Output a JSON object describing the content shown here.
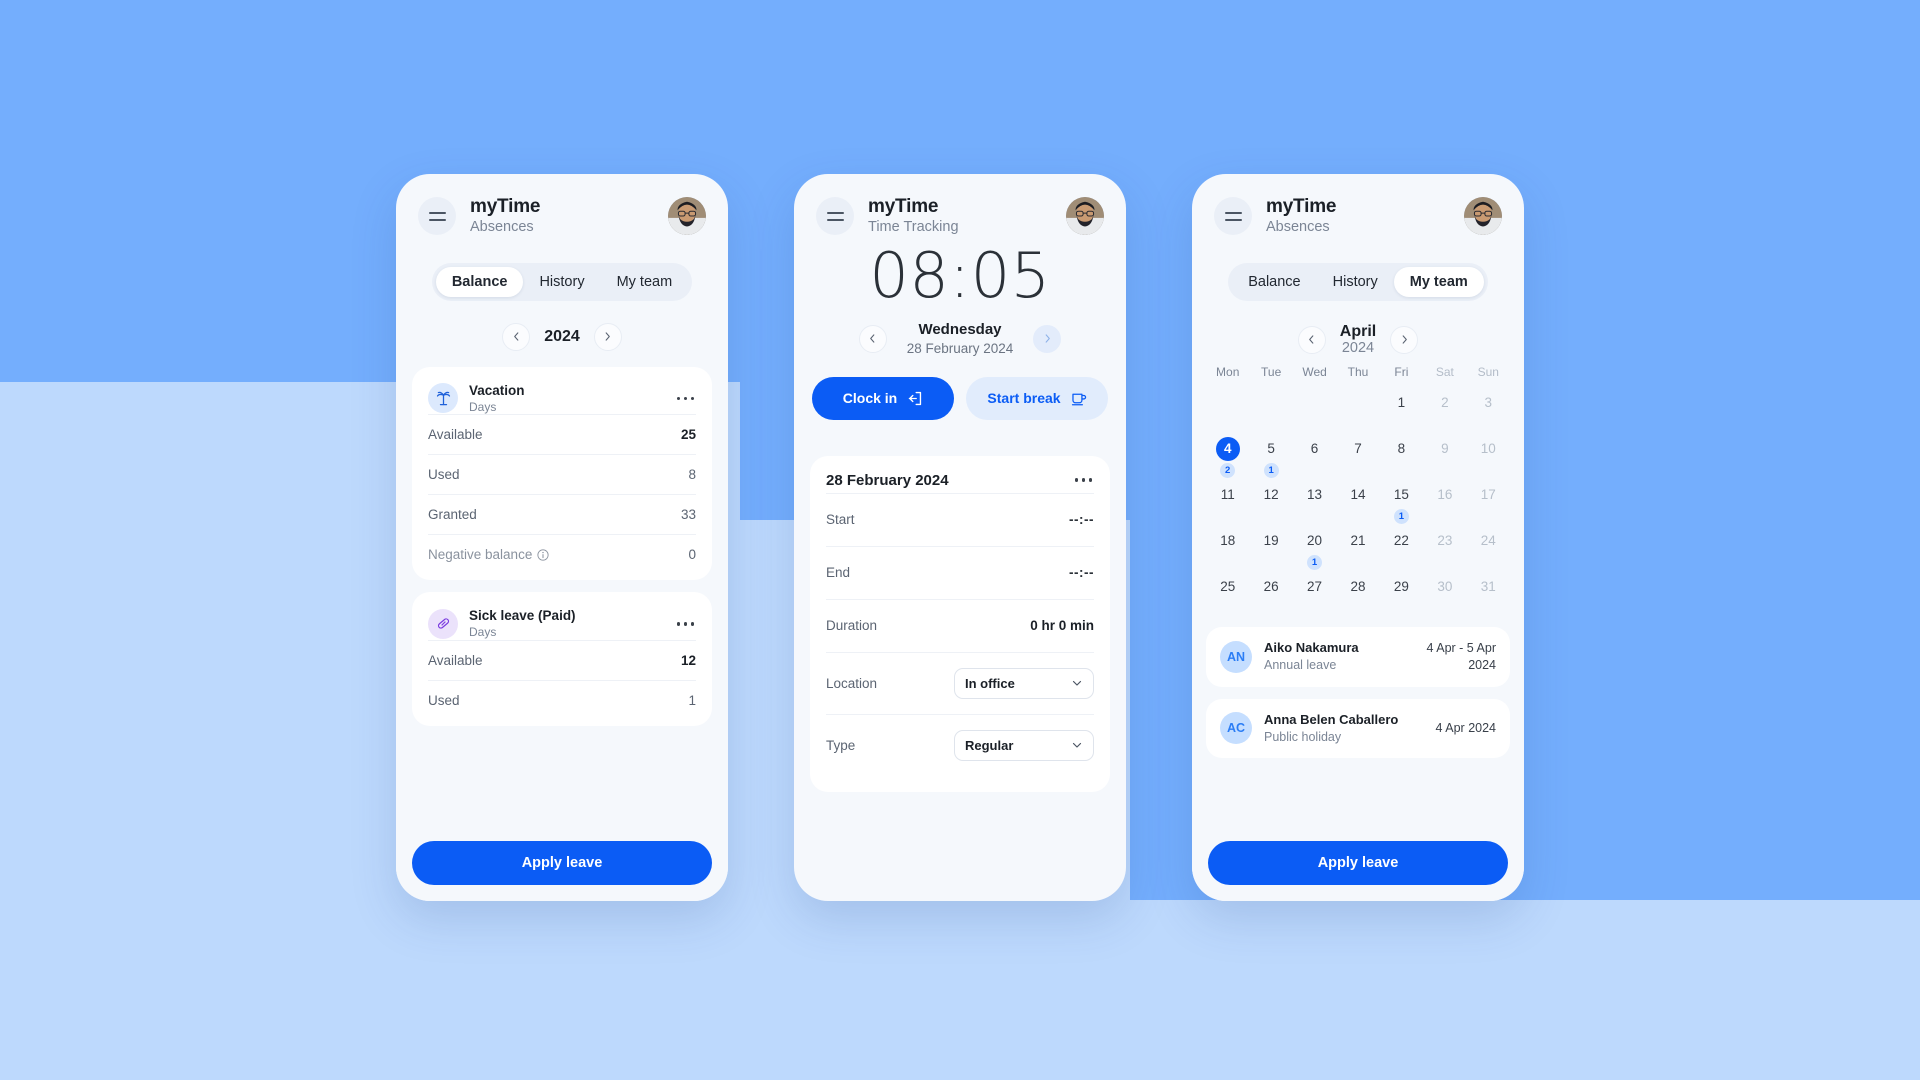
{
  "background": {
    "primary_blue": "#74aefd",
    "pale_blue": "#bdd9fd",
    "accent_blue": "#0b5cf5"
  },
  "phone1": {
    "header": {
      "title": "myTime",
      "subtitle": "Absences"
    },
    "tabs": [
      {
        "label": "Balance",
        "active": true
      },
      {
        "label": "History",
        "active": false
      },
      {
        "label": "My team",
        "active": false
      }
    ],
    "year_nav": {
      "prev": "‹",
      "value": "2024",
      "next": "›"
    },
    "cards": [
      {
        "icon": "palm-tree-icon",
        "name": "Vacation",
        "unit": "Days",
        "rows": [
          {
            "label": "Available",
            "value": "25",
            "strong": true
          },
          {
            "label": "Used",
            "value": "8",
            "strong": false
          },
          {
            "label": "Granted",
            "value": "33",
            "strong": false
          },
          {
            "label": "Negative balance",
            "value": "0",
            "strong": false,
            "info": true
          }
        ]
      },
      {
        "icon": "pill-icon",
        "name": "Sick leave (Paid)",
        "unit": "Days",
        "rows": [
          {
            "label": "Available",
            "value": "12",
            "strong": true
          },
          {
            "label": "Used",
            "value": "1",
            "strong": false
          }
        ]
      }
    ],
    "cta": "Apply leave"
  },
  "phone2": {
    "header": {
      "title": "myTime",
      "subtitle": "Time Tracking"
    },
    "clock": "08:05",
    "day_name": "Wednesday",
    "day_date": "28 February 2024",
    "prev_day_icon": "chevron-left-icon",
    "next_day_icon": "chevron-right-icon",
    "buttons": {
      "clock_in": "Clock in",
      "clock_in_icon": "login-arrow-icon",
      "start_break": "Start break",
      "start_break_icon": "coffee-cup-icon"
    },
    "entry": {
      "title": "28 February 2024",
      "rows": [
        {
          "label": "Start",
          "value": "--:--",
          "kind": "text"
        },
        {
          "label": "End",
          "value": "--:--",
          "kind": "text"
        },
        {
          "label": "Duration",
          "value": "0 hr 0 min",
          "kind": "text"
        },
        {
          "label": "Location",
          "value": "In office",
          "kind": "select"
        },
        {
          "label": "Type",
          "value": "Regular",
          "kind": "select"
        }
      ]
    }
  },
  "phone3": {
    "header": {
      "title": "myTime",
      "subtitle": "Absences"
    },
    "tabs": [
      {
        "label": "Balance",
        "active": false
      },
      {
        "label": "History",
        "active": false
      },
      {
        "label": "My team",
        "active": true
      }
    ],
    "month_nav": {
      "month": "April",
      "year": "2024"
    },
    "calendar": {
      "dow": [
        "Mon",
        "Tue",
        "Wed",
        "Thu",
        "Fri",
        "Sat",
        "Sun"
      ],
      "weeks": [
        [
          null,
          null,
          null,
          null,
          {
            "d": "1"
          },
          {
            "d": "2",
            "weekend": true
          },
          {
            "d": "3",
            "weekend": true
          }
        ],
        [
          {
            "d": "4",
            "selected": true,
            "badge": "2"
          },
          {
            "d": "5",
            "badge": "1"
          },
          {
            "d": "6"
          },
          {
            "d": "7"
          },
          {
            "d": "8"
          },
          {
            "d": "9",
            "weekend": true
          },
          {
            "d": "10",
            "weekend": true
          }
        ],
        [
          {
            "d": "11"
          },
          {
            "d": "12"
          },
          {
            "d": "13"
          },
          {
            "d": "14"
          },
          {
            "d": "15",
            "badge": "1"
          },
          {
            "d": "16",
            "weekend": true
          },
          {
            "d": "17",
            "weekend": true
          }
        ],
        [
          {
            "d": "18"
          },
          {
            "d": "19"
          },
          {
            "d": "20",
            "badge": "1"
          },
          {
            "d": "21"
          },
          {
            "d": "22"
          },
          {
            "d": "23",
            "weekend": true
          },
          {
            "d": "24",
            "weekend": true
          }
        ],
        [
          {
            "d": "25"
          },
          {
            "d": "26"
          },
          {
            "d": "27"
          },
          {
            "d": "28"
          },
          {
            "d": "29"
          },
          {
            "d": "30",
            "weekend": true
          },
          {
            "d": "31",
            "weekend": true
          }
        ]
      ]
    },
    "team": [
      {
        "initials": "AN",
        "name": "Aiko Nakamura",
        "type": "Annual leave",
        "date": "4 Apr - 5 Apr 2024"
      },
      {
        "initials": "AC",
        "name": "Anna Belen Caballero",
        "type": "Public holiday",
        "date": "4 Apr 2024"
      }
    ],
    "cta": "Apply leave"
  }
}
